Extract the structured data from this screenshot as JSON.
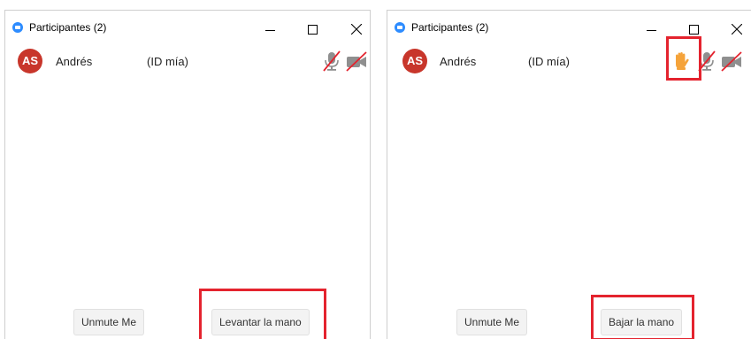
{
  "left_window": {
    "title": "Participantes (2)",
    "participant": {
      "initials": "AS",
      "name": "Andrés",
      "tag": "(ID mía)"
    },
    "buttons": {
      "unmute": "Unmute Me",
      "raise_hand": "Levantar la mano"
    }
  },
  "right_window": {
    "title": "Participantes (2)",
    "participant": {
      "initials": "AS",
      "name": "Andrés",
      "tag": "(ID mía)"
    },
    "buttons": {
      "unmute": "Unmute Me",
      "lower_hand": "Bajar la mano"
    }
  },
  "icons": {
    "app": "zoom-logo-icon",
    "minimize": "minimize-icon",
    "maximize": "maximize-icon",
    "close": "close-icon",
    "mic": "mic-muted-icon",
    "video": "video-off-icon",
    "hand": "raised-hand-icon"
  },
  "colors": {
    "avatar": "#c8362b",
    "highlight": "#e4232e",
    "hand": "#f5a33a",
    "zoom_blue": "#2d8cff"
  }
}
